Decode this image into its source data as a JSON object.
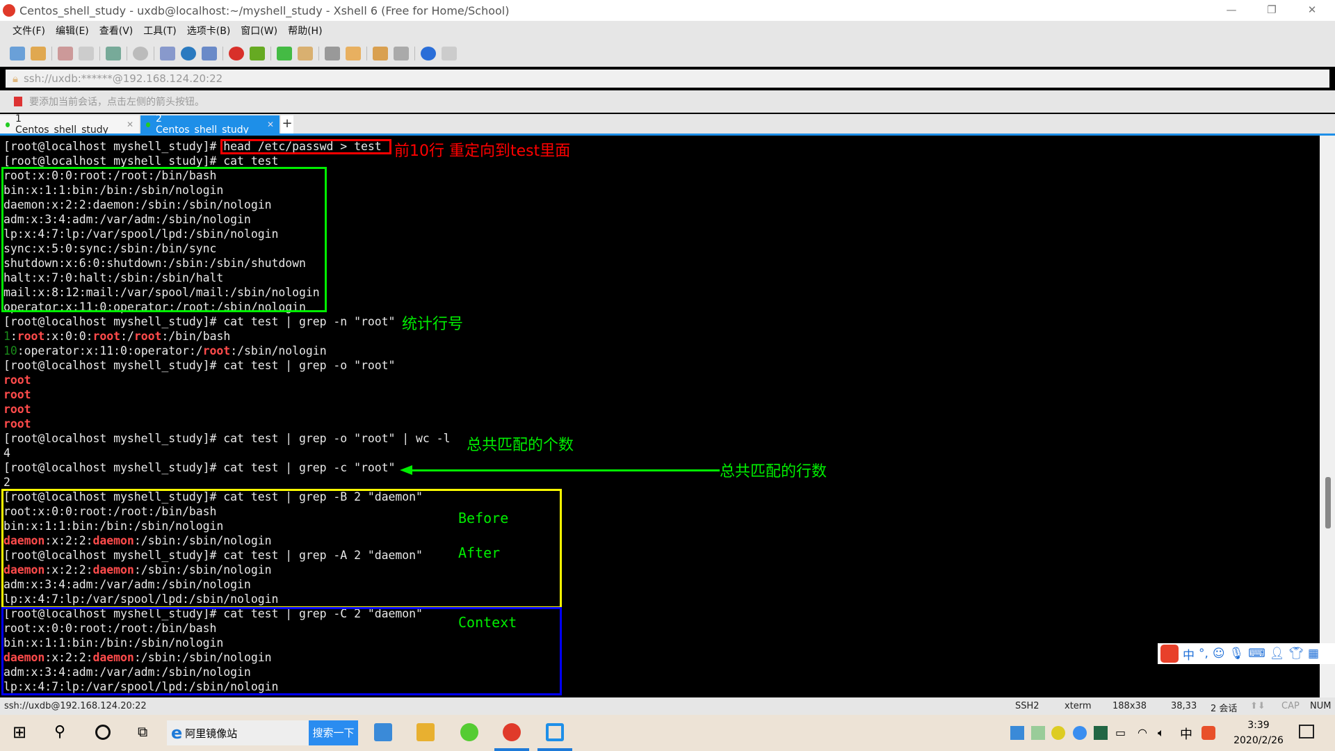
{
  "window": {
    "title": "Centos_shell_study - uxdb@localhost:~/myshell_study - Xshell 6 (Free for Home/School)"
  },
  "menu": [
    "文件(F)",
    "编辑(E)",
    "查看(V)",
    "工具(T)",
    "选项卡(B)",
    "窗口(W)",
    "帮助(H)"
  ],
  "address": "ssh://uxdb:******@192.168.124.20:22",
  "hint": "要添加当前会话，点击左侧的箭头按钮。",
  "tabs": [
    {
      "label": "1 Centos_shell_study",
      "active": false
    },
    {
      "label": "2 Centos_shell_study",
      "active": true
    }
  ],
  "terminal": {
    "lines": [
      [
        [
          "[root@localhost myshell_study]# head /etc/passwd > test",
          "n"
        ]
      ],
      [
        [
          "[root@localhost myshell_study]# cat test",
          "n"
        ]
      ],
      [
        [
          "root:x:0:0:root:/root:/bin/bash",
          "n"
        ]
      ],
      [
        [
          "bin:x:1:1:bin:/bin:/sbin/nologin",
          "n"
        ]
      ],
      [
        [
          "daemon:x:2:2:daemon:/sbin:/sbin/nologin",
          "n"
        ]
      ],
      [
        [
          "adm:x:3:4:adm:/var/adm:/sbin/nologin",
          "n"
        ]
      ],
      [
        [
          "lp:x:4:7:lp:/var/spool/lpd:/sbin/nologin",
          "n"
        ]
      ],
      [
        [
          "sync:x:5:0:sync:/sbin:/bin/sync",
          "n"
        ]
      ],
      [
        [
          "shutdown:x:6:0:shutdown:/sbin:/sbin/shutdown",
          "n"
        ]
      ],
      [
        [
          "halt:x:7:0:halt:/sbin:/sbin/halt",
          "n"
        ]
      ],
      [
        [
          "mail:x:8:12:mail:/var/spool/mail:/sbin/nologin",
          "n"
        ]
      ],
      [
        [
          "operator:x:11:0:operator:/root:/sbin/nologin",
          "n"
        ]
      ],
      [
        [
          "[root@localhost myshell_study]# cat test | grep -n \"root\"",
          "n"
        ]
      ],
      [
        [
          "1",
          "g"
        ],
        [
          ":",
          "n"
        ],
        [
          "root",
          "r"
        ],
        [
          ":x:0:0:",
          "n"
        ],
        [
          "root",
          "r"
        ],
        [
          ":/",
          "n"
        ],
        [
          "root",
          "r"
        ],
        [
          ":/bin/bash",
          "n"
        ]
      ],
      [
        [
          "10",
          "g"
        ],
        [
          ":operator:x:11:0:operator:/",
          "n"
        ],
        [
          "root",
          "r"
        ],
        [
          ":/sbin/nologin",
          "n"
        ]
      ],
      [
        [
          "[root@localhost myshell_study]# cat test | grep -o \"root\"",
          "n"
        ]
      ],
      [
        [
          "root",
          "r"
        ]
      ],
      [
        [
          "root",
          "r"
        ]
      ],
      [
        [
          "root",
          "r"
        ]
      ],
      [
        [
          "root",
          "r"
        ]
      ],
      [
        [
          "[root@localhost myshell_study]# cat test | grep -o \"root\" | wc -l",
          "n"
        ]
      ],
      [
        [
          "4",
          "n"
        ]
      ],
      [
        [
          "[root@localhost myshell_study]# cat test | grep -c \"root\"",
          "n"
        ]
      ],
      [
        [
          "2",
          "n"
        ]
      ],
      [
        [
          "[root@localhost myshell_study]# cat test | grep -B 2 \"daemon\"",
          "n"
        ]
      ],
      [
        [
          "root:x:0:0:root:/root:/bin/bash",
          "n"
        ]
      ],
      [
        [
          "bin:x:1:1:bin:/bin:/sbin/nologin",
          "n"
        ]
      ],
      [
        [
          "daemon",
          "r"
        ],
        [
          ":x:2:2:",
          "n"
        ],
        [
          "daemon",
          "r"
        ],
        [
          ":/sbin:/sbin/nologin",
          "n"
        ]
      ],
      [
        [
          "[root@localhost myshell_study]# cat test | grep -A 2 \"daemon\"",
          "n"
        ]
      ],
      [
        [
          "daemon",
          "r"
        ],
        [
          ":x:2:2:",
          "n"
        ],
        [
          "daemon",
          "r"
        ],
        [
          ":/sbin:/sbin/nologin",
          "n"
        ]
      ],
      [
        [
          "adm:x:3:4:adm:/var/adm:/sbin/nologin",
          "n"
        ]
      ],
      [
        [
          "lp:x:4:7:lp:/var/spool/lpd:/sbin/nologin",
          "n"
        ]
      ],
      [
        [
          "[root@localhost myshell_study]# cat test | grep -C 2 \"daemon\"",
          "n"
        ]
      ],
      [
        [
          "root:x:0:0:root:/root:/bin/bash",
          "n"
        ]
      ],
      [
        [
          "bin:x:1:1:bin:/bin:/sbin/nologin",
          "n"
        ]
      ],
      [
        [
          "daemon",
          "r"
        ],
        [
          ":x:2:2:",
          "n"
        ],
        [
          "daemon",
          "r"
        ],
        [
          ":/sbin:/sbin/nologin",
          "n"
        ]
      ],
      [
        [
          "adm:x:3:4:adm:/var/adm:/sbin/nologin",
          "n"
        ]
      ],
      [
        [
          "lp:x:4:7:lp:/var/spool/lpd:/sbin/nologin",
          "n"
        ]
      ]
    ]
  },
  "annotations": {
    "redirect": "前10行 重定向到test里面",
    "line_numbers": "统计行号",
    "match_count": "总共匹配的个数",
    "line_count": "总共匹配的行数",
    "before": "Before",
    "after": "After",
    "context": "Context"
  },
  "colors": {
    "red": "#ff0000",
    "green": "#00ee00",
    "yellow": "#ffff00",
    "blue": "#0000ff",
    "accent": "#1e8fe8"
  },
  "status": {
    "connection": "ssh://uxdb@192.168.124.20:22",
    "protocol": "SSH2",
    "term": "xterm",
    "size": "188x38",
    "cursor": "38,33",
    "sessions": "2 会话",
    "cap": "CAP",
    "num": "NUM"
  },
  "taskbar": {
    "search_text": "阿里镜像站",
    "search_button": "搜索一下",
    "time": "3:39",
    "date": "2020/2/26",
    "ime": "中"
  }
}
